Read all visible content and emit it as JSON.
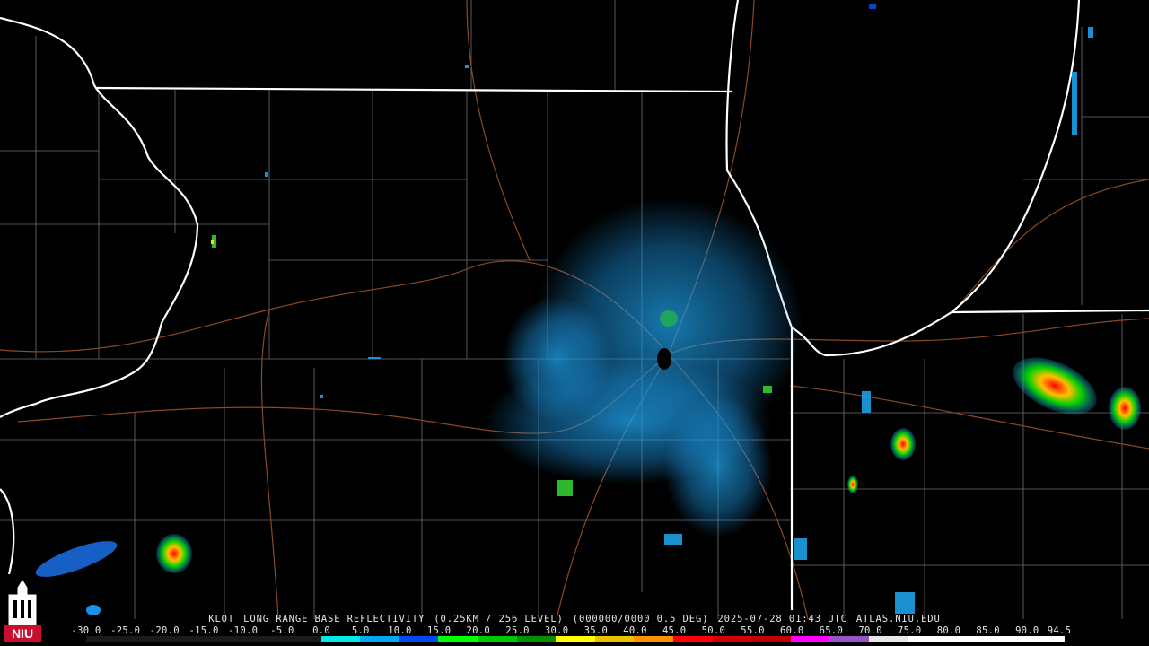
{
  "radar": {
    "station": "KLOT",
    "product": "LONG RANGE BASE REFLECTIVITY",
    "resolution": "(0.25KM / 256 LEVEL)",
    "code": "(000000/0000 0.5 DEG)",
    "timestamp": "2025-07-28 01:43 UTC",
    "source": "ATLAS.NIU.EDU"
  },
  "logo": {
    "text": "NIU",
    "color": "#c8102e"
  },
  "colorbar": {
    "ticks": [
      "-30.0",
      "-25.0",
      "-20.0",
      "-15.0",
      "-10.0",
      "-5.0",
      "0.0",
      "5.0",
      "10.0",
      "15.0",
      "20.0",
      "25.0",
      "30.0",
      "35.0",
      "40.0",
      "45.0",
      "50.0",
      "55.0",
      "60.0",
      "65.0",
      "70.0",
      "75.0",
      "80.0",
      "85.0",
      "90.0",
      "94.5"
    ],
    "colors": [
      "#000000",
      "#000000",
      "#000000",
      "#000000",
      "#000000",
      "#000000",
      "#00e8e8",
      "#00a8f0",
      "#0048f0",
      "#00ff00",
      "#00c800",
      "#009000",
      "#ffff00",
      "#e8c000",
      "#ff9000",
      "#ff0000",
      "#d00000",
      "#c00000",
      "#ff00ff",
      "#9855c8",
      "#e8e8e8",
      "#ffffff",
      "#ffffff",
      "#ffffff",
      "#ffffff"
    ]
  },
  "colors": {
    "state_border": "#ffffff",
    "county_border": "#6e6e6e",
    "road": "#8a4a25",
    "background": "#000000"
  }
}
